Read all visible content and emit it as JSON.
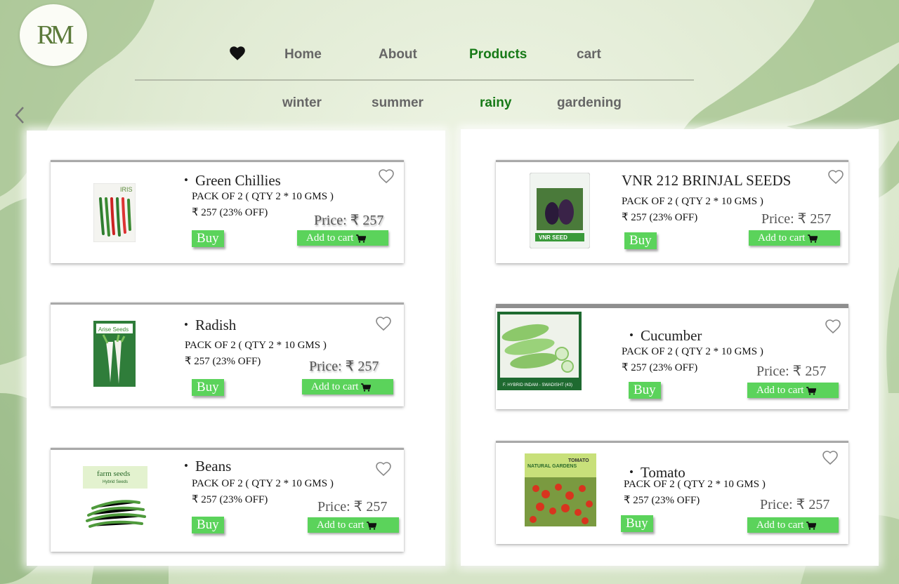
{
  "brand": {
    "logo_text": "RM"
  },
  "nav": {
    "items": [
      {
        "label": "Home"
      },
      {
        "label": "About"
      },
      {
        "label": "Products",
        "active": true
      },
      {
        "label": "cart"
      }
    ]
  },
  "categories": [
    {
      "label": "winter"
    },
    {
      "label": "summer"
    },
    {
      "label": "rainy",
      "active": true
    },
    {
      "label": "gardening"
    }
  ],
  "colors": {
    "accent": "#5bd35b",
    "active_nav": "#177a17",
    "nav_text": "#666666"
  },
  "products": [
    {
      "name": "Green Chillies",
      "pack": "PACK OF 2 ( QTY 2 * 10 GMS )",
      "offer": "₹ 257 (23% OFF)",
      "price": "Price: ₹ 257",
      "buy": "Buy",
      "add_to_cart": "Add to cart"
    },
    {
      "name": "Radish",
      "pack": "PACK OF 2 ( QTY 2 * 10 GMS )",
      "offer": "₹ 257 (23% OFF)",
      "price": "Price: ₹ 257",
      "buy": "Buy",
      "add_to_cart": "Add to cart"
    },
    {
      "name": "Beans",
      "pack": "PACK OF 2 ( QTY 2 * 10 GMS )",
      "offer": "₹ 257 (23% OFF)",
      "price": "Price: ₹ 257",
      "buy": "Buy",
      "add_to_cart": "Add to cart"
    },
    {
      "name": "VNR 212 BRINJAL SEEDS",
      "pack": "PACK OF 2 ( QTY 2 * 10 GMS )",
      "offer": "₹ 257 (23% OFF)",
      "price": "Price: ₹ 257",
      "buy": "Buy",
      "add_to_cart": "Add to cart"
    },
    {
      "name": "Cucumber",
      "pack": "PACK OF 2 ( QTY 2 * 10 GMS )",
      "offer": "₹ 257 (23% OFF)",
      "price": "Price: ₹ 257",
      "buy": "Buy",
      "add_to_cart": "Add to cart"
    },
    {
      "name": "Tomato",
      "pack": "PACK OF 2 ( QTY 2 * 10 GMS )",
      "offer": "₹ 257 (23% OFF)",
      "price": "Price: ₹ 257",
      "buy": "Buy",
      "add_to_cart": "Add to cart"
    }
  ],
  "package_labels": {
    "chillies": "IRIS",
    "radish": "Arise Seeds",
    "beans": "farm seeds",
    "beans_sub": "Hybrid Seeds",
    "brinjal": "VNR SEED",
    "cucumber": "F. HYBRID INDAM - SWADISHT (43)",
    "tomato_brand": "NATURAL GARDENS",
    "tomato_title": "TOMATO"
  }
}
